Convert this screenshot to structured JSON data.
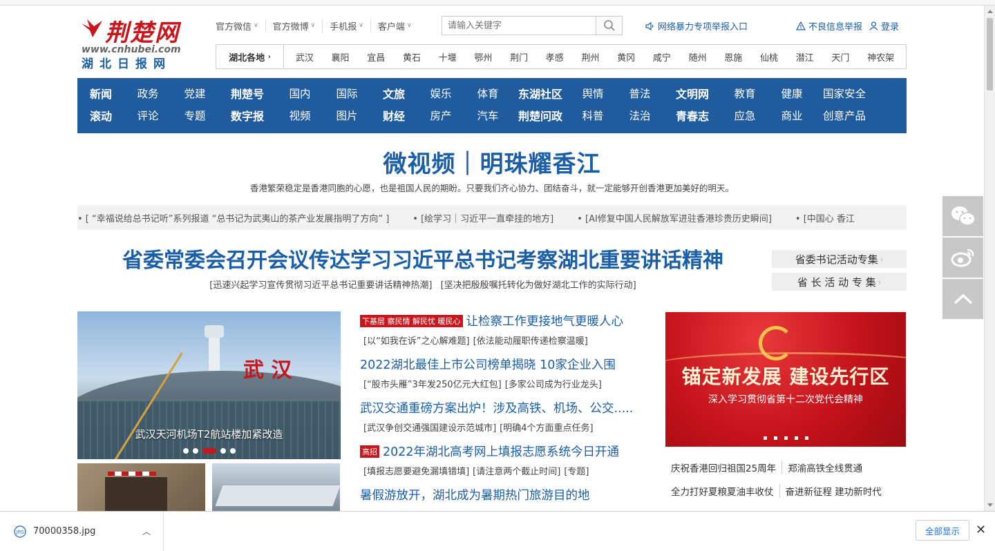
{
  "logo": {
    "name_cn": "荆楚网",
    "url": "www.cnhubei.com",
    "subtitle": "湖北日报网"
  },
  "toplinks": [
    {
      "label": "官方微信"
    },
    {
      "label": "官方微博"
    },
    {
      "label": "手机报"
    },
    {
      "label": "客户端"
    }
  ],
  "search": {
    "placeholder": "请输入关键字"
  },
  "report_link": "网络暴力专项举报入口",
  "right_links": {
    "bad_info": "不良信息举报",
    "login": "登录"
  },
  "regions": {
    "title": "湖北各地",
    "items": [
      "武汉",
      "襄阳",
      "宜昌",
      "黄石",
      "十堰",
      "鄂州",
      "荆门",
      "孝感",
      "荆州",
      "黄冈",
      "咸宁",
      "随州",
      "恩施",
      "仙桃",
      "潜江",
      "天门",
      "神农架"
    ]
  },
  "nav": {
    "row1": [
      "新闻",
      "政务",
      "党建",
      "荆楚号",
      "国内",
      "国际",
      "文旅",
      "娱乐",
      "体育",
      "东湖社区",
      "舆情",
      "普法",
      "文明网",
      "教育",
      "健康",
      "国家安全"
    ],
    "row2": [
      "滚动",
      "评论",
      "专题",
      "数字报",
      "视频",
      "图片",
      "财经",
      "房产",
      "汽车",
      "荆楚问政",
      "科普",
      "法治",
      "青春志",
      "应急",
      "商业",
      "创意产品"
    ]
  },
  "feature": {
    "title": "微视频｜明珠耀香江",
    "subtitle": "香港繁荣稳定是香港同胞的心愿，也是祖国人民的期盼。只要我们齐心协力、团结奋斗，就一定能够开创香港更加美好的明天。"
  },
  "ticker": [
    "• [ “幸福说给总书记听”系列报道  “总书记为武夷山的茶产业发展指明了方向” ]",
    "• [绘学习｜习近平一直牵挂的地方]",
    "• [AI修复中国人民解放军进驻香港珍贵历史瞬间]",
    "• [中国心 香江"
  ],
  "headline": {
    "title": "省委常委会召开会议传达学习习近平总书记考察湖北重要讲话精神",
    "subs": [
      "[迅速兴起学习宣传贯彻习近平总书记重要讲话精神热潮]",
      "[坚决把殷殷嘱托转化为做好湖北工作的实际行动]"
    ]
  },
  "specials": [
    "省委书记活动专集",
    "省 长 活 动 专 集"
  ],
  "slider": {
    "caption": "武汉天河机场T2航站楼加紧改造",
    "sign": "武 汉"
  },
  "news": [
    {
      "tag": "下基层 察民情 解民忧 暖民心",
      "title": "让检察工作更接地气更暖人心",
      "subs": [
        "[以“如我在诉”之心解难题]",
        "[依法能动履职传递检察温暖]"
      ]
    },
    {
      "tag": "",
      "title": "2022湖北最佳上市公司榜单揭晓 10家企业入围",
      "subs": [
        "[“股市头雁”3年发250亿元大红包]",
        "[多家公司成为行业龙头]"
      ]
    },
    {
      "tag": "",
      "title": "武汉交通重磅方案出炉！涉及高铁、机场、公交.....",
      "subs": [
        "[武汉争创交通强国建设示范城市]",
        "[明确4个方面重点任务]"
      ]
    },
    {
      "tag": "高招",
      "title": "2022年湖北高考网上填报志愿系统今日开通",
      "subs": [
        "[填报志愿要避免漏填错填]",
        "[请注意两个截止时间]",
        "[专题]"
      ]
    },
    {
      "tag": "",
      "title": "暑假游放开，湖北成为暑期热门旅游目的地",
      "subs": []
    }
  ],
  "banner": {
    "title": "锚定新发展  建设先行区",
    "subtitle": "深入学习贯彻省第十二次党代会精神"
  },
  "topics": [
    [
      "庆祝香港回归祖国25周年",
      "郑渝高铁全线贯通"
    ],
    [
      "全力打好夏粮夏油丰收仗",
      "奋进新征程 建功新时代"
    ]
  ],
  "download": {
    "filename": "70000358.jpg",
    "show_all": "全部显示"
  },
  "colors": {
    "brand_blue": "#1f5b9d",
    "brand_red": "#c8161d"
  }
}
